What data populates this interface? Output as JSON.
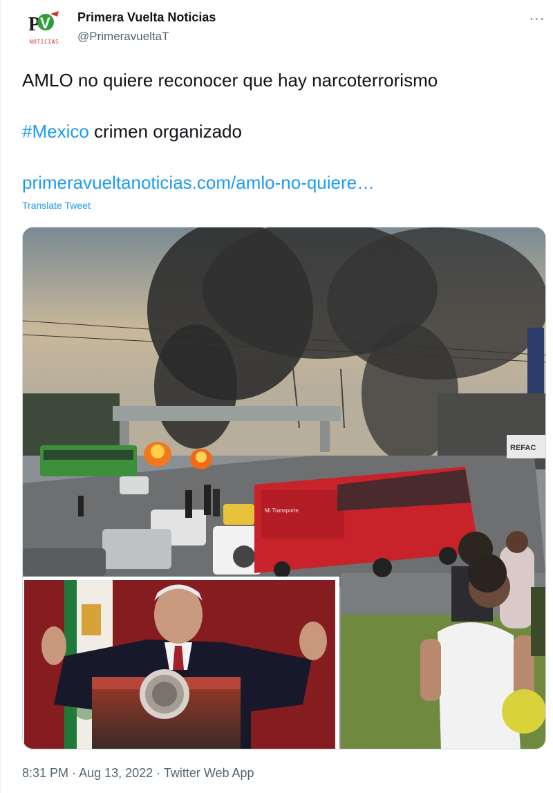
{
  "author": {
    "display_name": "Primera Vuelta Noticias",
    "handle": "@PrimeravueltaT",
    "avatar_label": "NOTICIAS",
    "avatar_icon": "pv-logo-icon"
  },
  "more_icon": "more-horizontal-icon",
  "more_label": "···",
  "tweet": {
    "line1": "AMLO no quiere reconocer que hay narcoterrorismo",
    "hashtag": "#Mexico",
    "line2_rest": " crimen organizado",
    "link": "primeravueltanoticias.com/amlo-no-quiere…",
    "translate": "Translate Tweet"
  },
  "media": {
    "bus_label": "Mi Transporte",
    "shop_sign": "REFAC"
  },
  "footer": {
    "time": "8:31 PM",
    "sep1": " · ",
    "date": "Aug 13, 2022",
    "sep2": " · ",
    "source": "Twitter Web App"
  },
  "colors": {
    "link": "#1d9bf0",
    "secondary_text": "#536471",
    "bus_red": "#c8222b"
  }
}
